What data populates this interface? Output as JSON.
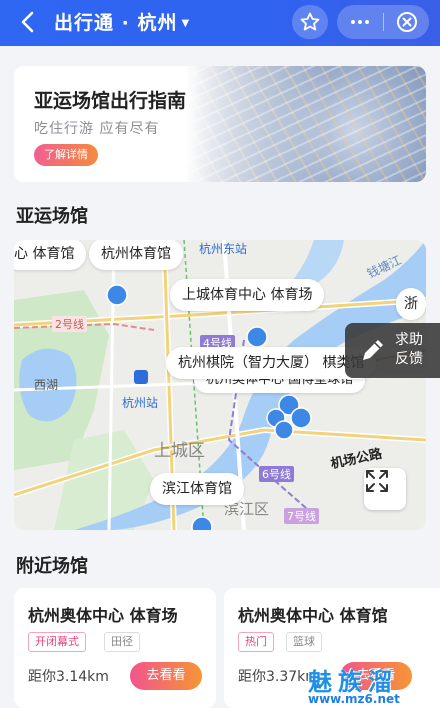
{
  "header": {
    "title": "出行通 · 杭州",
    "background_color": "#2f66f2"
  },
  "hero": {
    "title": "亚运场馆出行指南",
    "subtitle": "吃住行游  应有尽有",
    "button_label": "了解详情"
  },
  "venues_section": {
    "title": "亚运场馆"
  },
  "map": {
    "venue_labels": [
      "心 体育馆",
      "杭州体育馆",
      "上城体育中心 体育场",
      "浙",
      "杭州棋院（智力大厦） 棋类馆",
      "杭州奥体中心 国博壁球馆",
      "滨江体育馆"
    ],
    "place_labels": {
      "hangzhou_east_station": "杭州东站",
      "qiantang_river": "钱塘江",
      "line_2": "2号线",
      "line_4": "4号线",
      "line_6": "6号线",
      "line_7": "7号线",
      "west_lake": "西湖",
      "hangzhou_station": "杭州站",
      "shangcheng_district": "上城区",
      "binjiang_district": "滨江区",
      "airport_road": "机场公路"
    }
  },
  "feedback": {
    "line1": "求助",
    "line2": "反馈"
  },
  "nearby_section": {
    "title": "附近场馆",
    "cards": [
      {
        "name": "杭州奥体中心 体育场",
        "tags": [
          "开闭幕式",
          "田径"
        ],
        "distance": "距你3.14km",
        "button_label": "去看看"
      },
      {
        "name": "杭州奥体中心 体育馆",
        "tags": [
          "热门",
          "篮球"
        ],
        "distance": "距你3.37km",
        "button_label": "去看看"
      }
    ]
  },
  "watermark": {
    "brand": "魅族溜",
    "url": "www.mz6.net"
  },
  "colors": {
    "accent_pink": "#f2548e",
    "accent_orange": "#f59634",
    "map_water": "#a6cdf5",
    "map_green": "#cfe8c7"
  }
}
